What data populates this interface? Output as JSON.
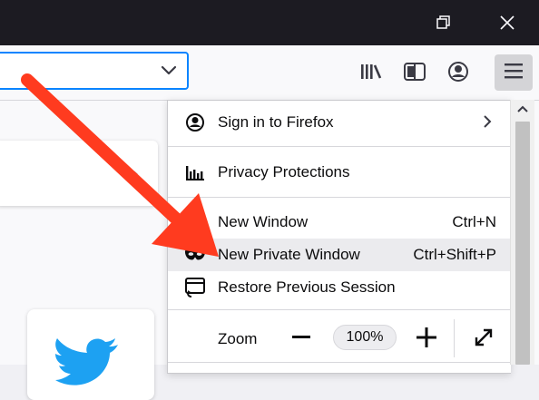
{
  "window_controls": {
    "restore_icon": "restore-icon",
    "close_icon": "close-icon"
  },
  "toolbar": {
    "urlbar_dropdown_icon": "chevron-down-icon",
    "library_icon": "library-icon",
    "sidebar_icon": "sidebar-icon",
    "account_icon": "account-icon",
    "menu_icon": "hamburger-menu-icon"
  },
  "menu": {
    "sign_in": {
      "label": "Sign in to Firefox",
      "icon": "account-icon"
    },
    "privacy": {
      "label": "Privacy Protections",
      "icon": "chart-icon"
    },
    "new_window": {
      "label": "New Window",
      "shortcut": "Ctrl+N",
      "icon": "new-window-icon"
    },
    "private_window": {
      "label": "New Private Window",
      "shortcut": "Ctrl+Shift+P",
      "icon": "private-mask-icon"
    },
    "restore_session": {
      "label": "Restore Previous Session",
      "icon": "restore-session-icon"
    },
    "zoom": {
      "label": "Zoom",
      "value": "100%"
    }
  },
  "colors": {
    "titlebar": "#1c1b22",
    "urlbar_focus": "#0a84ff",
    "annotation_arrow": "#ff3b1f",
    "highlight": "#ebebee",
    "twitter": "#1da1f2"
  }
}
